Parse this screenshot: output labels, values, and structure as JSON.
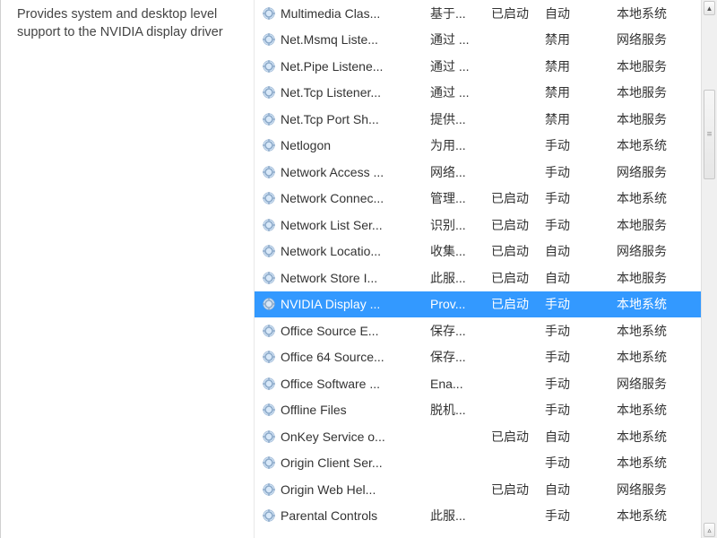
{
  "description": "Provides system and desktop level support to the NVIDIA display driver",
  "selected_index": 11,
  "columns": [
    "name",
    "desc",
    "status",
    "startup",
    "logon"
  ],
  "services": [
    {
      "name": "Multimedia Clas...",
      "desc": "基于...",
      "status": "已启动",
      "startup": "自动",
      "logon": "本地系统"
    },
    {
      "name": "Net.Msmq Liste...",
      "desc": "通过 ...",
      "status": "",
      "startup": "禁用",
      "logon": "网络服务"
    },
    {
      "name": "Net.Pipe Listene...",
      "desc": "通过 ...",
      "status": "",
      "startup": "禁用",
      "logon": "本地服务"
    },
    {
      "name": "Net.Tcp Listener...",
      "desc": "通过 ...",
      "status": "",
      "startup": "禁用",
      "logon": "本地服务"
    },
    {
      "name": "Net.Tcp Port Sh...",
      "desc": "提供...",
      "status": "",
      "startup": "禁用",
      "logon": "本地服务"
    },
    {
      "name": "Netlogon",
      "desc": "为用...",
      "status": "",
      "startup": "手动",
      "logon": "本地系统"
    },
    {
      "name": "Network Access ...",
      "desc": "网络...",
      "status": "",
      "startup": "手动",
      "logon": "网络服务"
    },
    {
      "name": "Network Connec...",
      "desc": "管理...",
      "status": "已启动",
      "startup": "手动",
      "logon": "本地系统"
    },
    {
      "name": "Network List Ser...",
      "desc": "识别...",
      "status": "已启动",
      "startup": "手动",
      "logon": "本地服务"
    },
    {
      "name": "Network Locatio...",
      "desc": "收集...",
      "status": "已启动",
      "startup": "自动",
      "logon": "网络服务"
    },
    {
      "name": "Network Store I...",
      "desc": "此服...",
      "status": "已启动",
      "startup": "自动",
      "logon": "本地服务"
    },
    {
      "name": "NVIDIA Display ...",
      "desc": "Prov...",
      "status": "已启动",
      "startup": "手动",
      "logon": "本地系统"
    },
    {
      "name": "Office  Source E...",
      "desc": "保存...",
      "status": "",
      "startup": "手动",
      "logon": "本地系统"
    },
    {
      "name": "Office 64 Source...",
      "desc": "保存...",
      "status": "",
      "startup": "手动",
      "logon": "本地系统"
    },
    {
      "name": "Office Software ...",
      "desc": "Ena...",
      "status": "",
      "startup": "手动",
      "logon": "网络服务"
    },
    {
      "name": "Offline Files",
      "desc": "脱机...",
      "status": "",
      "startup": "手动",
      "logon": "本地系统"
    },
    {
      "name": "OnKey Service o...",
      "desc": "",
      "status": "已启动",
      "startup": "自动",
      "logon": "本地系统"
    },
    {
      "name": "Origin Client Ser...",
      "desc": "",
      "status": "",
      "startup": "手动",
      "logon": "本地系统"
    },
    {
      "name": "Origin Web Hel...",
      "desc": "",
      "status": "已启动",
      "startup": "自动",
      "logon": "网络服务"
    },
    {
      "name": "Parental Controls",
      "desc": "此服...",
      "status": "",
      "startup": "手动",
      "logon": "本地系统"
    }
  ]
}
